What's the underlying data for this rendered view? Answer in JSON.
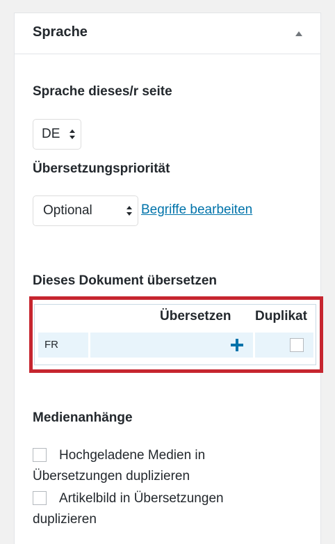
{
  "panel": {
    "title": "Sprache"
  },
  "language": {
    "label": "Sprache dieses/r seite",
    "selected": "DE"
  },
  "priority": {
    "label": "Übersetzungspriorität",
    "selected": "Optional",
    "edit_terms_link": "Begriffe bearbeiten"
  },
  "translate": {
    "label": "Dieses Dokument übersetzen",
    "columns": [
      "Übersetzen",
      "Duplikat"
    ],
    "rows": [
      {
        "lang": "FR",
        "duplicate_checked": false
      }
    ]
  },
  "media": {
    "label": "Medienanhänge",
    "option1_line1": "Hochgeladene Medien in",
    "option1_line2": "Übersetzungen duplizieren",
    "option1_checked": false,
    "option2_line1": "Artikelbild in Übersetzungen",
    "option2_line2": "duplizieren",
    "option2_checked": false
  },
  "colors": {
    "link": "#0073aa",
    "highlight_frame": "#c6252f",
    "row_background": "#e8f4fb"
  }
}
